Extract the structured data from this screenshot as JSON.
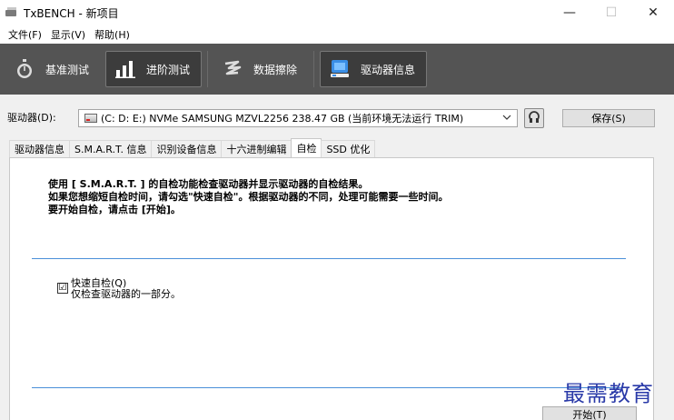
{
  "window": {
    "title": "TxBENCH - 新项目",
    "minimize": "—",
    "maximize": "☐",
    "close": "✕"
  },
  "menu": [
    "文件(F)",
    "显示(V)",
    "帮助(H)"
  ],
  "toolbar": {
    "tabs": [
      {
        "label": "基准测试",
        "icon": "stopwatch-icon"
      },
      {
        "label": "进阶测试",
        "icon": "bar-chart-icon"
      },
      {
        "label": "数据擦除",
        "icon": "erase-icon"
      },
      {
        "label": "驱动器信息",
        "icon": "drive-info-icon",
        "active": true
      }
    ]
  },
  "drive": {
    "label": "驱动器(D):",
    "selected": "(C: D: E:) NVMe SAMSUNG MZVL2256  238.47 GB (当前环境无法运行 TRIM)",
    "save_label": "保存(S)"
  },
  "tabs": [
    {
      "label": "驱动器信息"
    },
    {
      "label": "S.M.A.R.T. 信息"
    },
    {
      "label": "识别设备信息"
    },
    {
      "label": "十六进制编辑"
    },
    {
      "label": "自检",
      "active": true
    },
    {
      "label": "SSD 优化"
    }
  ],
  "selftest": {
    "desc": [
      "使用 [ S.M.A.R.T. ] 的自检功能检查驱动器并显示驱动器的自检结果。",
      "如果您想缩短自检时间，请勾选\"快速自检\"。根据驱动器的不同，处理可能需要一些时间。",
      "要开始自检，请点击 [开始]。"
    ],
    "quick_label": "快速自检(Q)",
    "quick_desc": "仅检查驱动器的一部分。",
    "quick_checked": "☑",
    "start_label": "开始(T)"
  },
  "watermark": "最需教育"
}
